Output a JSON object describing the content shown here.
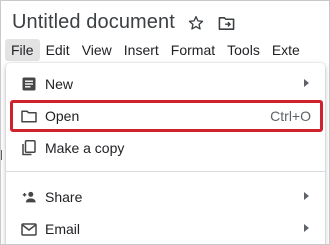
{
  "document": {
    "title": "Untitled document"
  },
  "title_icons": [
    {
      "name": "star-icon"
    },
    {
      "name": "move-to-folder-icon"
    }
  ],
  "menubar": {
    "items": [
      "File",
      "Edit",
      "View",
      "Insert",
      "Format",
      "Tools",
      "Exte"
    ],
    "active": "File"
  },
  "file_menu": {
    "items": [
      {
        "label": "New",
        "icon": "document-icon",
        "has_submenu": true
      },
      {
        "label": "Open",
        "icon": "folder-icon",
        "shortcut": "Ctrl+O",
        "highlighted": true
      },
      {
        "label": "Make a copy",
        "icon": "copy-icon"
      },
      {
        "label": "Share",
        "icon": "add-person-icon",
        "has_submenu": true
      },
      {
        "label": "Email",
        "icon": "email-icon",
        "has_submenu": true
      }
    ]
  },
  "colors": {
    "highlight_border": "#d0222c",
    "menu_active_bg": "#e3e3e3",
    "text": "#202124",
    "icon": "#444746"
  }
}
